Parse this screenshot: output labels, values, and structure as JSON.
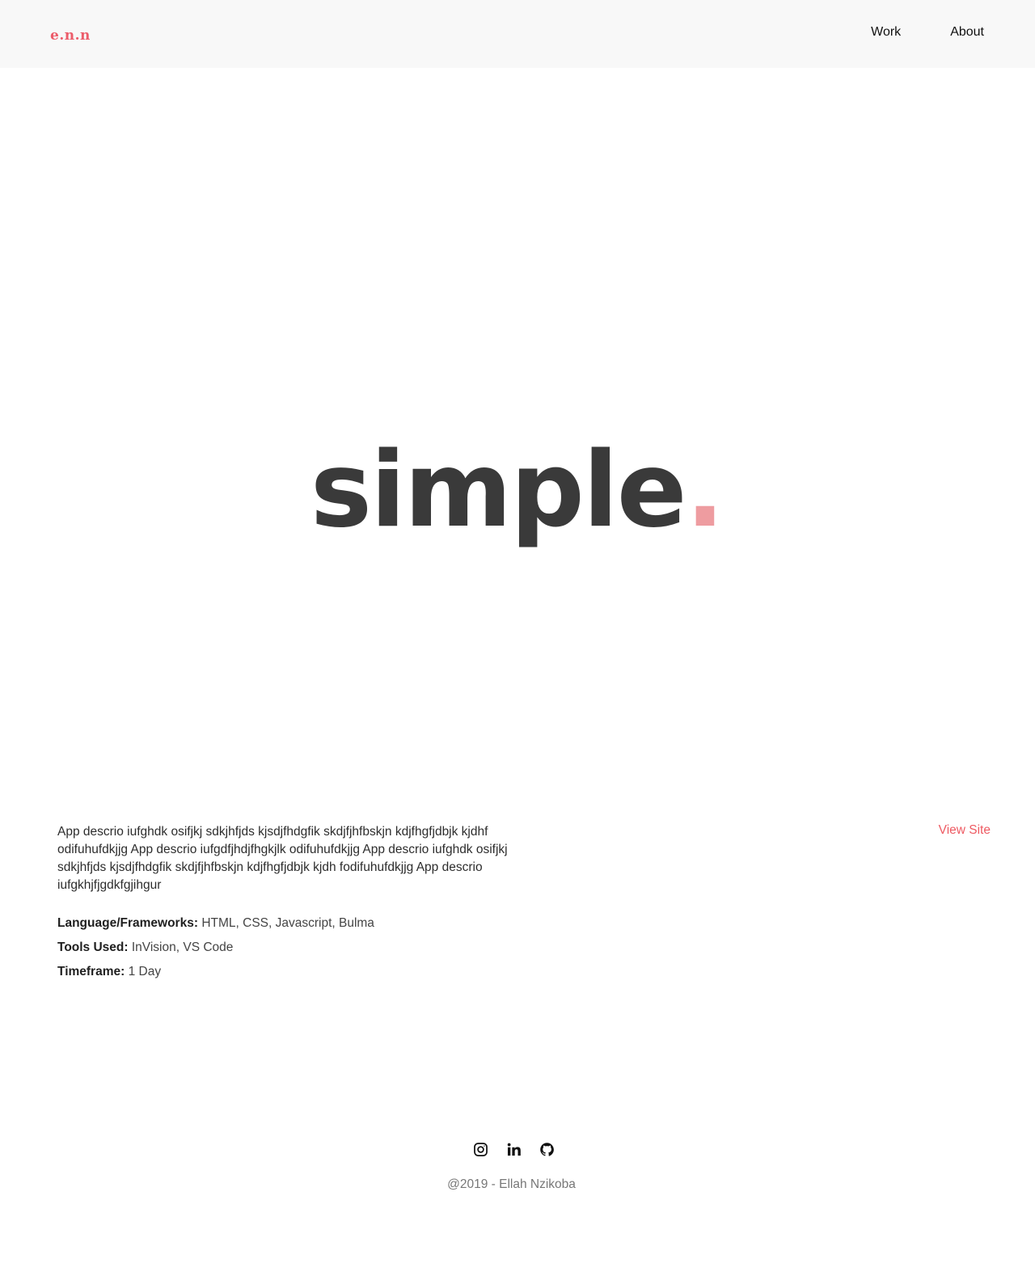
{
  "header": {
    "logo": "e.n.n",
    "nav": [
      {
        "label": "Work"
      },
      {
        "label": "About"
      }
    ]
  },
  "hero": {
    "word": "simple",
    "dot": "."
  },
  "project": {
    "description": "App descrio iufghdk osifjkj sdkjhfjds kjsdjfhdgfik skdjfjhfbskjn kdjfhgfjdbjk kjdhf odifuhufdkjjg App descrio iufgdfjhdjfhgkjlk odifuhufdkjjg App descrio iufghdk osifjkj sdkjhfjds kjsdjfhdgfik skdjfjhfbskjn kdjfhgfjdbjk kjdh fodifuhufdkjjg App descrio iufgkhjfjgdkfgjihgur",
    "view_site_label": "View Site",
    "meta": [
      {
        "key": "Language/Frameworks:",
        "value": "HTML, CSS, Javascript, Bulma"
      },
      {
        "key": "Tools Used:",
        "value": "InVision, VS Code"
      },
      {
        "key": "Timeframe:",
        "value": "1 Day"
      }
    ]
  },
  "footer": {
    "social_icons": [
      "instagram-icon",
      "linkedin-icon",
      "github-icon"
    ],
    "copyright": "@2019 - Ellah Nzikoba"
  },
  "colors": {
    "accent": "#ec5c6a",
    "hero_dot": "#ee9ca0",
    "hero_text": "#3a3a3a",
    "header_bg": "#f8f8f8"
  }
}
